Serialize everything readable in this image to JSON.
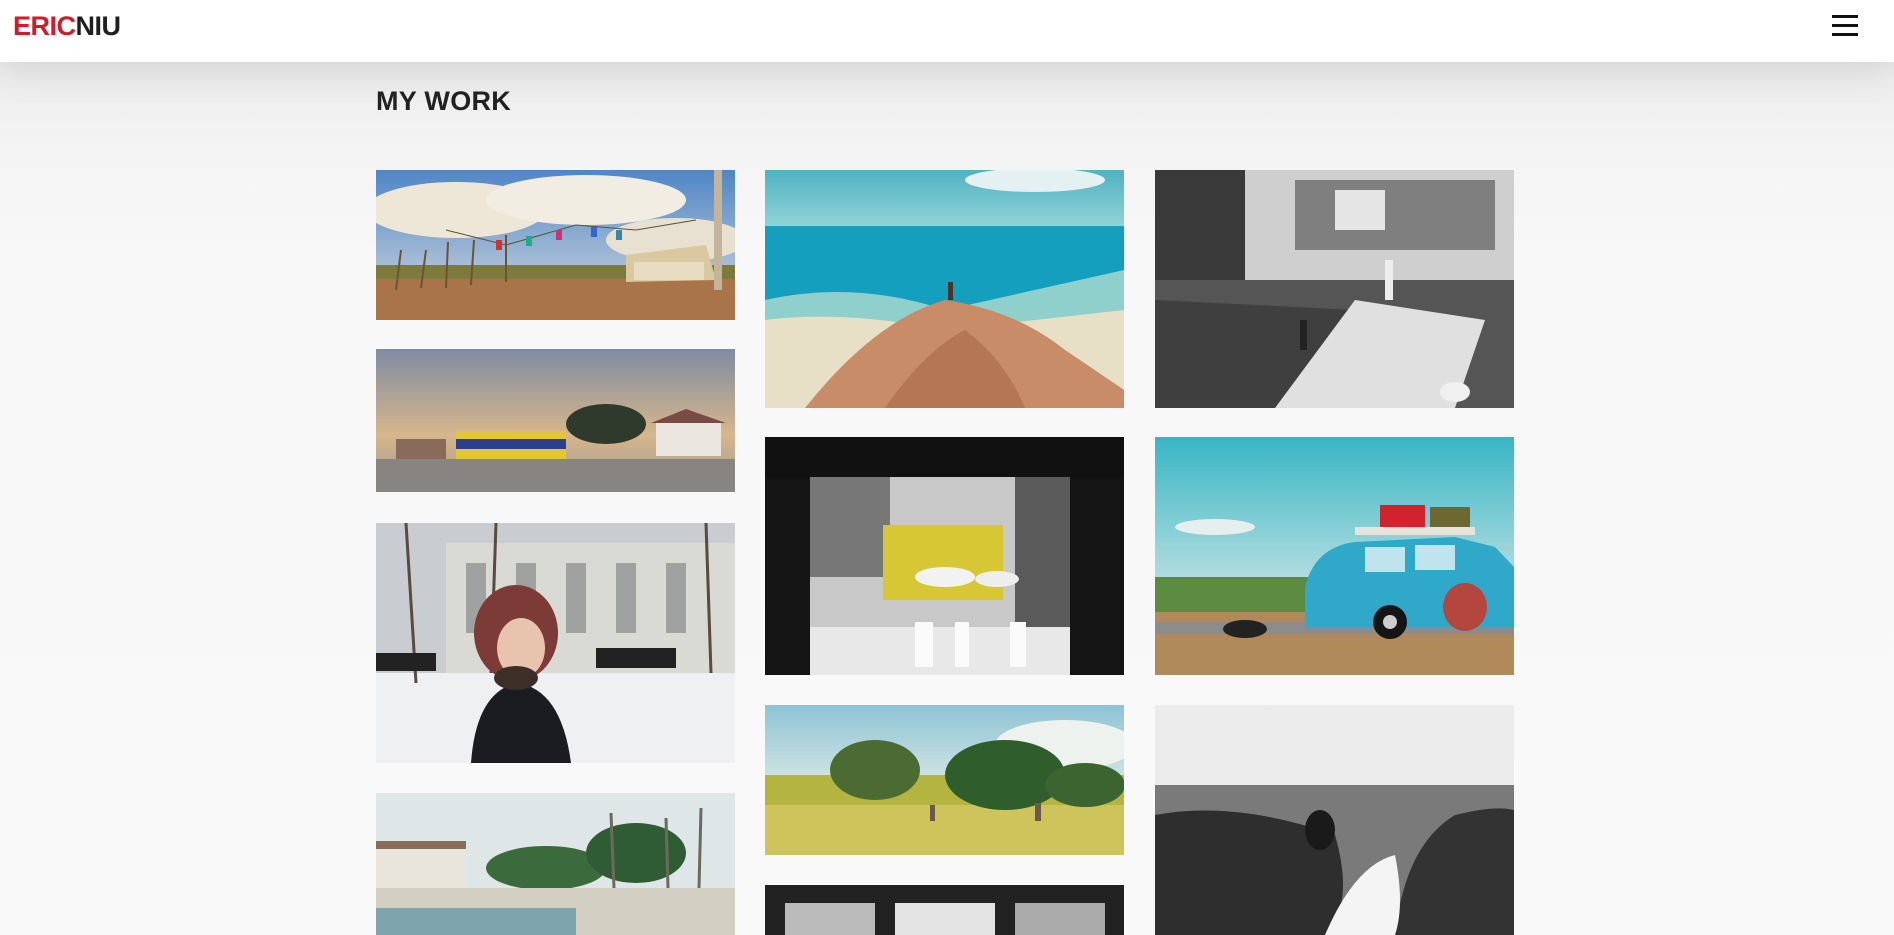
{
  "header": {
    "logo_part1": "ERIC",
    "logo_part2": "NIU",
    "menu_icon": "hamburger-menu-icon"
  },
  "main": {
    "title": "MY WORK"
  },
  "colors": {
    "brand_red": "#d11a2a",
    "text_dark": "#222222"
  }
}
